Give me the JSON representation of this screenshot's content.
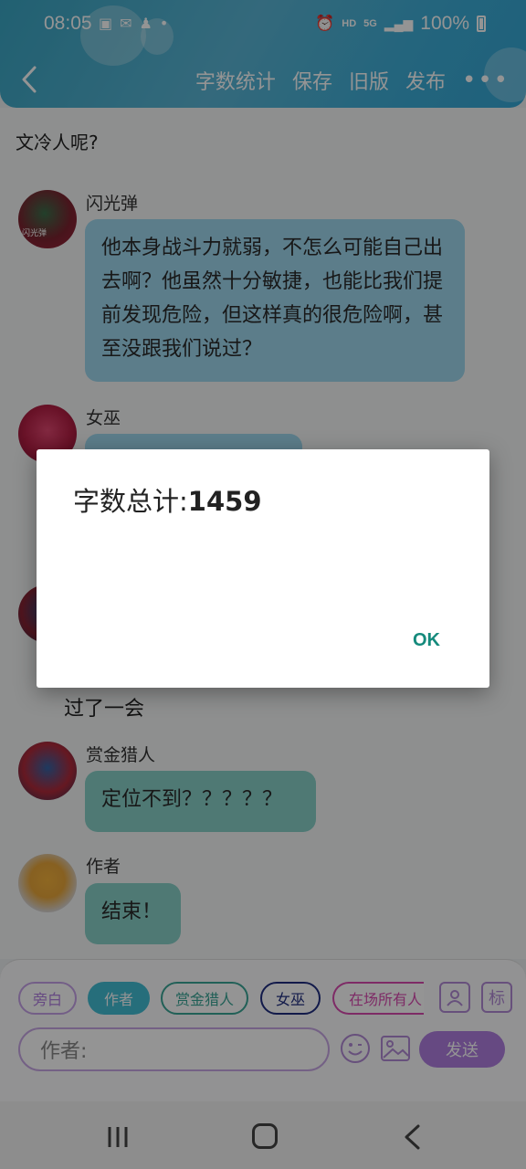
{
  "status_bar": {
    "time": "08:05",
    "network": "HD",
    "signal": "5G",
    "battery": "100%"
  },
  "toolbar": {
    "word_count": "字数统计",
    "save": "保存",
    "old_version": "旧版",
    "publish": "发布",
    "more": "•••"
  },
  "chat": {
    "narration_top": "文冷人呢?",
    "messages": [
      {
        "name": "闪光弹",
        "text": "他本身战斗力就弱，不怎么可能自己出去啊？他虽然十分敏捷，也能比我们提前发现危险，但这样真的很危险啊，甚至没跟我们说过？",
        "avatar_label": "闪光弹"
      },
      {
        "name": "女巫",
        "text": ""
      },
      {
        "name": "",
        "text": ""
      },
      {
        "name": "赏金猎人",
        "text": "定位不到？？？？？"
      },
      {
        "name": "作者",
        "text": "结束！"
      }
    ],
    "narration_mid": "过了一会"
  },
  "composer": {
    "chips": [
      "旁白",
      "作者",
      "赏金猎人",
      "女巫",
      "在场所有人"
    ],
    "active_chip": "作者",
    "label_icon": "标",
    "input_value": "作者:",
    "send": "发送"
  },
  "dialog": {
    "label": "字数总计:",
    "count": "1459",
    "ok": "OK"
  },
  "colors": {
    "accent": "#43bdd4",
    "purple": "#b07fe0",
    "dialog_button": "#158a7c"
  }
}
